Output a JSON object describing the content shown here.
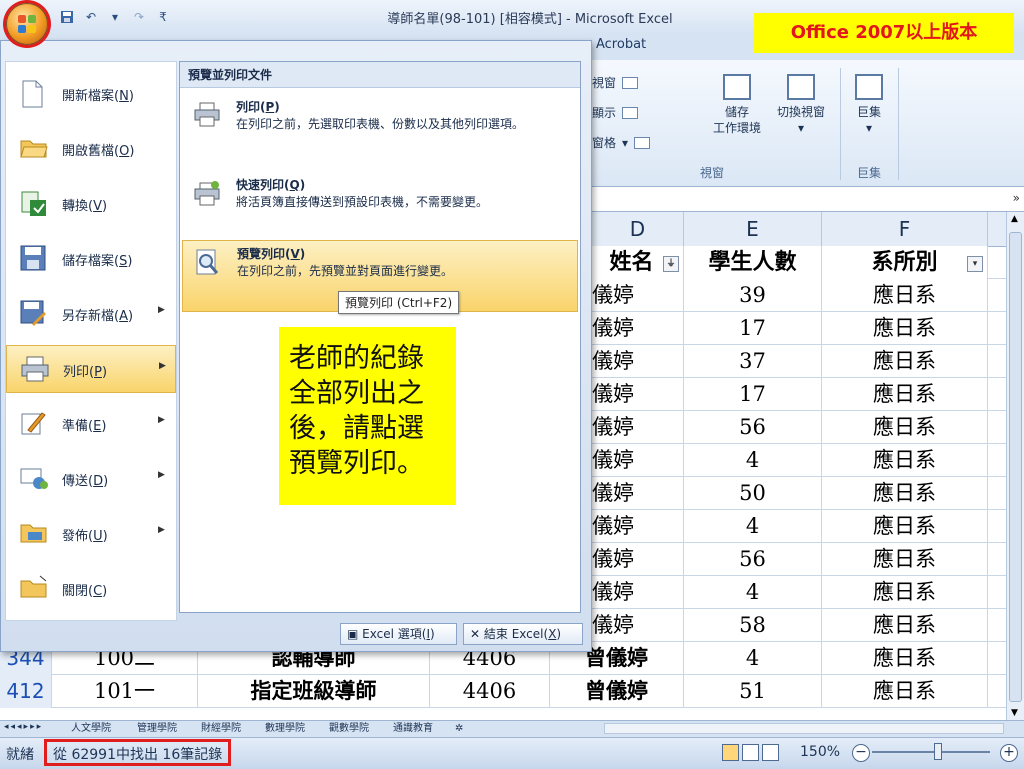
{
  "window": {
    "title": "導師名單(98-101)  [相容模式] - Microsoft Excel",
    "version_badge": "Office 2007以上版本"
  },
  "ribbon": {
    "visible_tab": "Acrobat",
    "small_buttons": [
      "視窗",
      "顯示",
      "窗格"
    ],
    "big_buttons": [
      {
        "label": "儲存\n工作環境",
        "icon": "save-workspace-icon"
      },
      {
        "label": "切換視窗",
        "icon": "switch-windows-icon"
      },
      {
        "label": "巨集",
        "icon": "macros-icon"
      }
    ],
    "group_labels": [
      "視窗",
      "巨集"
    ]
  },
  "office_menu": {
    "items": [
      {
        "label": "開新檔案",
        "key": "N",
        "icon": "new-file-icon",
        "arrow": false
      },
      {
        "label": "開啟舊檔",
        "key": "O",
        "icon": "open-folder-icon",
        "arrow": false
      },
      {
        "label": "轉換",
        "key": "V",
        "icon": "convert-icon",
        "arrow": false
      },
      {
        "label": "儲存檔案",
        "key": "S",
        "icon": "save-icon",
        "arrow": false
      },
      {
        "label": "另存新檔",
        "key": "A",
        "icon": "save-as-icon",
        "arrow": true
      },
      {
        "label": "列印",
        "key": "P",
        "icon": "print-icon",
        "arrow": true,
        "active": true
      },
      {
        "label": "準備",
        "key": "E",
        "icon": "prepare-icon",
        "arrow": true
      },
      {
        "label": "傳送",
        "key": "D",
        "icon": "send-icon",
        "arrow": true
      },
      {
        "label": "發佈",
        "key": "U",
        "icon": "publish-icon",
        "arrow": true
      },
      {
        "label": "關閉",
        "key": "C",
        "icon": "close-folder-icon",
        "arrow": false
      }
    ],
    "submenu_title": "預覽並列印文件",
    "submenu": [
      {
        "name": "列印",
        "key": "P",
        "desc": "在列印之前，先選取印表機、份數以及其他列印選項。",
        "icon": "printer-icon"
      },
      {
        "name": "快速列印",
        "key": "Q",
        "desc": "將活頁簿直接傳送到預設印表機，不需要變更。",
        "icon": "quick-print-icon"
      },
      {
        "name": "預覽列印",
        "key": "V",
        "desc": "在列印之前，先預覽並對頁面進行變更。",
        "icon": "print-preview-icon",
        "active": true
      }
    ],
    "tooltip": "預覽列印 (Ctrl+F2)",
    "footer": {
      "options_label": "Excel 選項",
      "options_key": "I",
      "exit_label": "結束 Excel",
      "exit_key": "X"
    }
  },
  "note_lines": [
    "老師的紀錄",
    "全部列出之",
    "後，請點選",
    "預覽列印。"
  ],
  "sheet": {
    "col_headers": [
      "D",
      "E",
      "F"
    ],
    "header_row": [
      "姓名",
      "學生人數",
      "系所別"
    ],
    "rows": [
      {
        "name": "儀婷",
        "count": "39",
        "dept": "應日系"
      },
      {
        "name": "儀婷",
        "count": "17",
        "dept": "應日系"
      },
      {
        "name": "儀婷",
        "count": "37",
        "dept": "應日系"
      },
      {
        "name": "儀婷",
        "count": "17",
        "dept": "應日系"
      },
      {
        "name": "儀婷",
        "count": "56",
        "dept": "應日系"
      },
      {
        "name": "儀婷",
        "count": "4",
        "dept": "應日系"
      },
      {
        "name": "儀婷",
        "count": "50",
        "dept": "應日系"
      },
      {
        "name": "儀婷",
        "count": "4",
        "dept": "應日系"
      },
      {
        "name": "儀婷",
        "count": "56",
        "dept": "應日系"
      },
      {
        "name": "儀婷",
        "count": "4",
        "dept": "應日系"
      },
      {
        "name": "儀婷",
        "count": "58",
        "dept": "應日系"
      }
    ],
    "full_rows": [
      {
        "rownum": "344",
        "term": "100二",
        "role": "認輔導師",
        "code": "4406",
        "name": "曾儀婷",
        "count": "4",
        "dept": "應日系"
      },
      {
        "rownum": "412",
        "term": "101一",
        "role": "指定班級導師",
        "code": "4406",
        "name": "曾儀婷",
        "count": "51",
        "dept": "應日系"
      }
    ]
  },
  "sheet_tabs": [
    "人文學院",
    "管理學院",
    "財經學院",
    "數理學院",
    "觀數學院",
    "通識教育"
  ],
  "status": {
    "ready": "就緒",
    "found": "從 62991中找出 16筆記錄",
    "zoom": "150%"
  }
}
